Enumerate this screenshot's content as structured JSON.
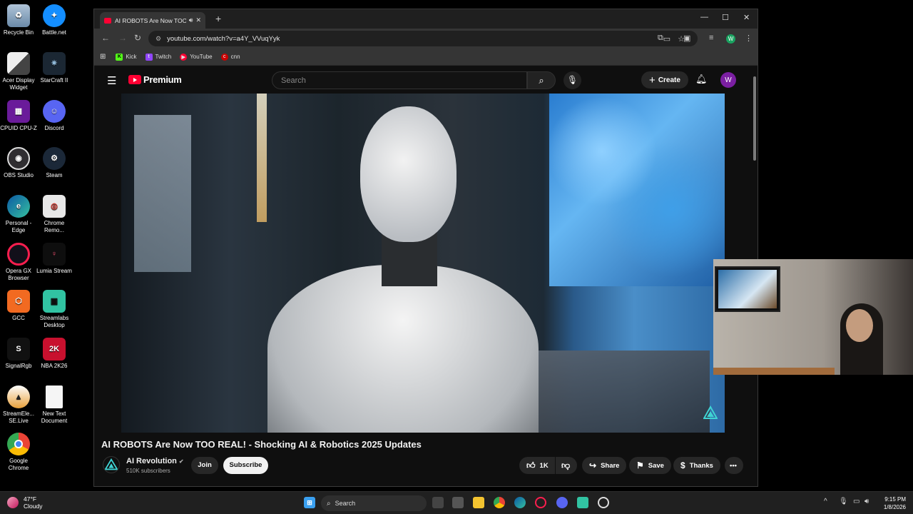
{
  "desktop": {
    "icons": [
      {
        "label": "Recycle Bin",
        "icon": "recycle-bin-icon"
      },
      {
        "label": "Battle.net",
        "icon": "battlenet-icon"
      },
      {
        "label": "Acer Display Widget",
        "icon": "acer-widget-icon"
      },
      {
        "label": "StarCraft II",
        "icon": "starcraft-icon"
      },
      {
        "label": "CPUID CPU-Z",
        "icon": "cpuz-icon"
      },
      {
        "label": "Discord",
        "icon": "discord-icon"
      },
      {
        "label": "OBS Studio",
        "icon": "obs-icon"
      },
      {
        "label": "Steam",
        "icon": "steam-icon"
      },
      {
        "label": "Personal - Edge",
        "icon": "edge-icon"
      },
      {
        "label": "Chrome Remo...",
        "icon": "chrome-remote-icon"
      },
      {
        "label": "Opera GX Browser",
        "icon": "opera-gx-icon"
      },
      {
        "label": "Lumia Stream",
        "icon": "lumia-icon"
      },
      {
        "label": "GCC",
        "icon": "gcc-icon"
      },
      {
        "label": "Streamlabs Desktop",
        "icon": "streamlabs-icon"
      },
      {
        "label": "SignalRgb",
        "icon": "signalrgb-icon"
      },
      {
        "label": "NBA 2K26",
        "icon": "nba2k-icon"
      },
      {
        "label": "StreamEle... SE.Live",
        "icon": "streamelements-icon"
      },
      {
        "label": "New Text Document",
        "icon": "text-document-icon"
      },
      {
        "label": "Google Chrome",
        "icon": "chrome-icon"
      }
    ]
  },
  "browser": {
    "tab_title": "AI ROBOTS Are Now TOO R",
    "url": "youtube.com/watch?v=a4Y_VVuqYyk",
    "profile_initial": "W",
    "bookmarks": [
      {
        "label": "Kick",
        "color": "#53fc18"
      },
      {
        "label": "Twitch",
        "color": "#9146ff"
      },
      {
        "label": "YouTube",
        "color": "#ff0033"
      },
      {
        "label": "cnn",
        "color": "#cc0000"
      }
    ]
  },
  "youtube": {
    "logo_text": "Premium",
    "search_placeholder": "Search",
    "create_label": "Create",
    "avatar_initial": "W",
    "video_title": "AI ROBOTS Are Now TOO REAL! - Shocking AI & Robotics 2025 Updates",
    "channel_name": "AI Revolution",
    "subscribers": "510K subscribers",
    "join_label": "Join",
    "subscribe_label": "Subscribe",
    "like_count": "1K",
    "share_label": "Share",
    "save_label": "Save",
    "thanks_label": "Thanks",
    "accent": "#ff0033"
  },
  "taskbar": {
    "temperature": "47°F",
    "condition": "Cloudy",
    "search_label": "Search",
    "time": "9:15 PM",
    "date": "1/8/2026"
  }
}
